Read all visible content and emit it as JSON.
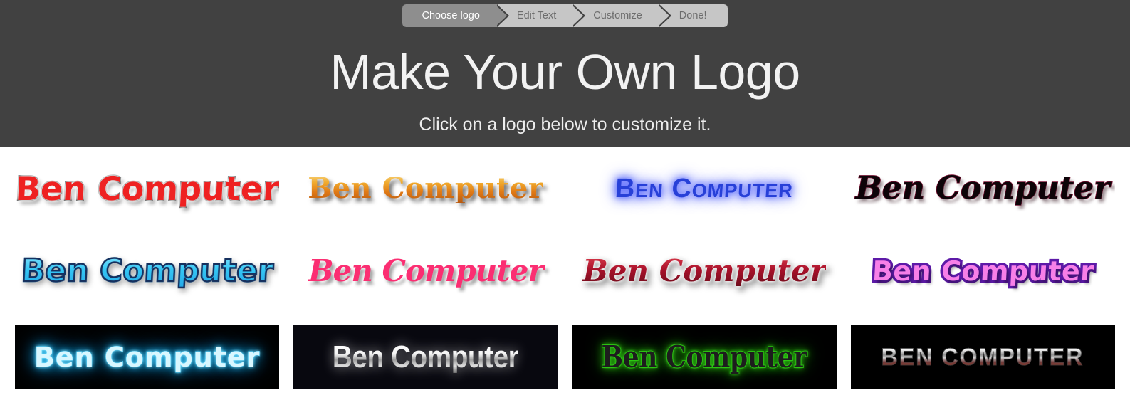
{
  "header": {
    "title": "Make Your Own Logo",
    "subtitle": "Click on a logo below to customize it.",
    "background_color": "#414141"
  },
  "steps": {
    "active_index": 0,
    "active_bg": "#8e8e8e",
    "inactive_bg": "#c6c6c6",
    "items": [
      {
        "label": "Choose logo",
        "active": true
      },
      {
        "label": "Edit Text",
        "active": false
      },
      {
        "label": "Customize",
        "active": false
      },
      {
        "label": "Done!",
        "active": false
      }
    ]
  },
  "logo_grid": {
    "columns": 4,
    "rows": 3,
    "logo_text": "Ben Computer",
    "items": [
      {
        "index": 1,
        "text": "Ben Computer",
        "style_name": "red-bubble-outline",
        "text_color": "#ee2222",
        "outline_color": "#111111",
        "background": "#ffffff"
      },
      {
        "index": 2,
        "text": "Ben Computer",
        "style_name": "gold-gradient-serif",
        "text_color": "#f0a92c",
        "outline_color": "#b85a10",
        "background": "#ffffff"
      },
      {
        "index": 3,
        "text": "Ben Computer",
        "style_name": "blue-glow-smallcaps",
        "text_color": "#2740d8",
        "outline_color": "#ffffff",
        "background": "#ffffff"
      },
      {
        "index": 4,
        "text": "Ben Computer",
        "style_name": "black-calligraphic-crimson-edge",
        "text_color": "#0d0408",
        "outline_color": "#7d1436",
        "background": "#ffffff"
      },
      {
        "index": 5,
        "text": "Ben Computer",
        "style_name": "cyan-bubble-navy-outline",
        "text_color": "#35c6f4",
        "outline_color": "#16305e",
        "background": "#ffffff"
      },
      {
        "index": 6,
        "text": "Ben Computer",
        "style_name": "pink-script-white-outline",
        "text_color": "#fb2e72",
        "outline_color": "#ffffff",
        "background": "#ffffff"
      },
      {
        "index": 7,
        "text": "Ben Computer",
        "style_name": "dark-red-italic-serif",
        "text_color": "#a8112a",
        "outline_color": "#ffffff",
        "background": "#ffffff"
      },
      {
        "index": 8,
        "text": "Ben Computer",
        "style_name": "pink-purple-bubble-caps",
        "text_color": "#f77fe8",
        "outline_color": "#5d1aa8",
        "background": "#ffffff"
      },
      {
        "index": 9,
        "text": "Ben Computer",
        "style_name": "cyan-neon-tube",
        "text_color": "#4fd8ff",
        "outline_color": "#2ec6ff",
        "background": "#000000"
      },
      {
        "index": 10,
        "text": "Ben Computer",
        "style_name": "silver-chrome-condensed",
        "text_color": "#e8e8e8",
        "outline_color": "#9d9d9d",
        "background": "#08080f"
      },
      {
        "index": 11,
        "text": "Ben Computer",
        "style_name": "green-glow-dark-serif",
        "text_color": "#1d1d1d",
        "outline_color": "#27b010",
        "background": "#000000"
      },
      {
        "index": 12,
        "text": "BEN COMPUTER",
        "style_name": "metallic-chrome-caps",
        "text_color": "#cfcfcf",
        "outline_color": "#8d3b2e",
        "background": "#000000"
      }
    ]
  }
}
